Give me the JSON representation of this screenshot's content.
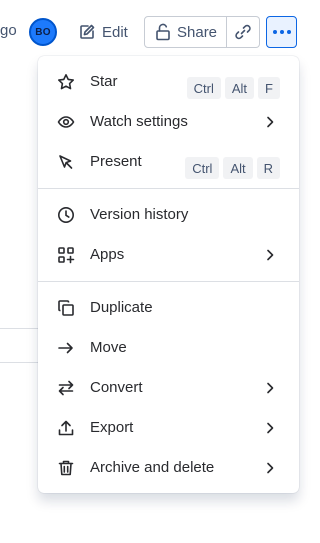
{
  "toolbar": {
    "time_suffix": "go",
    "avatar_initials": "BO",
    "edit_label": "Edit",
    "share_label": "Share"
  },
  "menu": {
    "items": [
      {
        "label": "Star",
        "icon": "star-icon",
        "shortcut": [
          "Ctrl",
          "Alt",
          "F"
        ]
      },
      {
        "label": "Watch settings",
        "icon": "eye-icon",
        "submenu": true
      },
      {
        "label": "Present",
        "icon": "present-icon",
        "shortcut": [
          "Ctrl",
          "Alt",
          "R"
        ]
      },
      {
        "label": "Version history",
        "icon": "clock-icon"
      },
      {
        "label": "Apps",
        "icon": "apps-icon",
        "submenu": true
      },
      {
        "label": "Duplicate",
        "icon": "duplicate-icon"
      },
      {
        "label": "Move",
        "icon": "arrow-right-icon"
      },
      {
        "label": "Convert",
        "icon": "swap-icon",
        "submenu": true
      },
      {
        "label": "Export",
        "icon": "upload-icon",
        "submenu": true
      },
      {
        "label": "Archive and delete",
        "icon": "trash-icon",
        "submenu": true
      }
    ]
  },
  "colors": {
    "accent": "#0c66e4",
    "accent_bg": "#e9f2ff",
    "avatar_bg": "#1d7afc",
    "text": "#292a2e",
    "subtle_text": "#44546f",
    "border": "#c7ccd4",
    "divider": "#dcdfe4",
    "kbd_bg": "#f1f2f4"
  }
}
